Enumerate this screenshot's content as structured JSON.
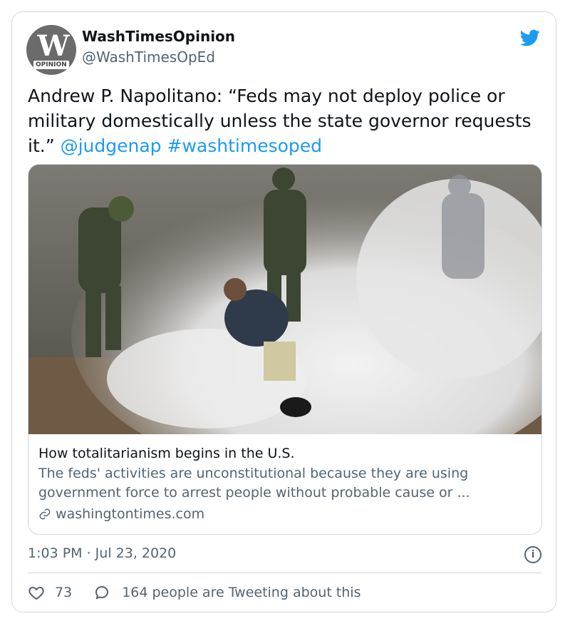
{
  "author": {
    "name": "WashTimesOpinion",
    "handle": "@WashTimesOpEd",
    "avatar_tag": "OPINION",
    "avatar_monogram": "W"
  },
  "tweet": {
    "text": "Andrew P. Napolitano: “Feds may not deploy police or military domestically unless the state governor requests it.”",
    "mention": "@judgenap",
    "hashtag": "#washtimesoped"
  },
  "card": {
    "title": "How totalitarianism begins in the U.S.",
    "description": "The feds' activities are unconstitutional because they are using government force to arrest people without probable cause or ...",
    "domain": "washingtontimes.com"
  },
  "meta": {
    "timestamp": "1:03 PM · Jul 23, 2020"
  },
  "actions": {
    "likes": "73",
    "conversation": "164 people are Tweeting about this"
  },
  "icons": {
    "platform": "twitter-bird-icon",
    "info": "info-icon",
    "link": "link-icon",
    "like": "heart-icon",
    "reply": "speech-bubble-icon"
  },
  "colors": {
    "accent": "#1d9bf0",
    "secondary_text": "#536471",
    "border": "#cfd9de"
  }
}
